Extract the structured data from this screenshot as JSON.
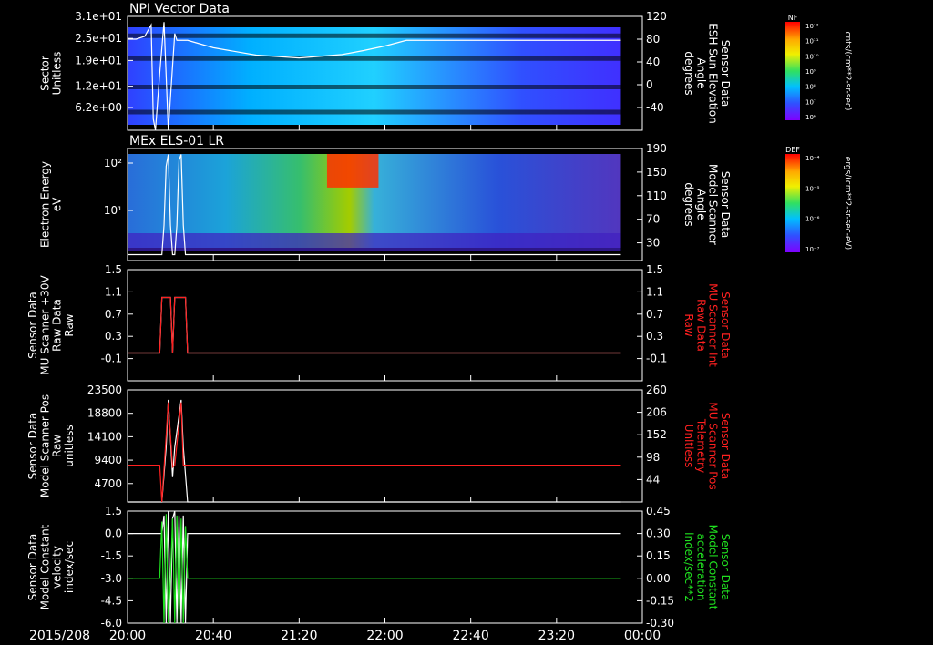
{
  "footer": {
    "date_label": "2015/208"
  },
  "time_axis": {
    "range_minutes": [
      0,
      240
    ],
    "ticks": [
      {
        "t": 0,
        "label": "20:00"
      },
      {
        "t": 40,
        "label": "20:40"
      },
      {
        "t": 80,
        "label": "21:20"
      },
      {
        "t": 120,
        "label": "22:00"
      },
      {
        "t": 160,
        "label": "22:40"
      },
      {
        "t": 200,
        "label": "23:20"
      },
      {
        "t": 240,
        "label": "00:00"
      }
    ]
  },
  "colors": {
    "background": "#000000",
    "axis": "#ffffff",
    "red_series": "#ff2020",
    "green_series": "#20e020"
  },
  "chart_data": [
    {
      "type": "heatmap",
      "title": "NPI Vector Data",
      "ylabel": "Sector\nUnitless",
      "ylim": [
        0,
        31
      ],
      "yticks": [
        "3.1e+01",
        "2.5e+01",
        "1.9e+01",
        "1.2e+01",
        "6.2e+00"
      ],
      "ytick_values": [
        31,
        25,
        19,
        12,
        6.2
      ],
      "y2label": "Sensor Data\nESH Sun Elevation\nAngle\ndegrees",
      "y2lim": [
        -80,
        120
      ],
      "y2ticks": [
        "120",
        "80",
        "40",
        "0",
        "-40"
      ],
      "y2tick_values": [
        120,
        80,
        40,
        0,
        -40
      ],
      "colorbar": {
        "label": "NF",
        "units": "cnts/(cm**2-sr-sec)",
        "ticks": [
          "10¹²",
          "10¹¹",
          "10¹⁰",
          "10⁹",
          "10⁸",
          "10⁷",
          "10⁶"
        ]
      },
      "line_series": [
        {
          "x": [
            0,
            4,
            8,
            11,
            12,
            13,
            15,
            17,
            19,
            22,
            23,
            25,
            28,
            40,
            60,
            80,
            100,
            110,
            120,
            130,
            150,
            175,
            200,
            230
          ],
          "y": [
            80,
            80,
            85,
            105,
            -60,
            -80,
            20,
            110,
            -80,
            90,
            78,
            78,
            78,
            65,
            52,
            47,
            53,
            60,
            68,
            78,
            78,
            78,
            78,
            78
          ]
        }
      ]
    },
    {
      "type": "heatmap",
      "title": "MEx ELS-01 LR",
      "ylabel": "Electron Energy\neV",
      "yscale": "log",
      "yticks": [
        "10²",
        "10¹"
      ],
      "y2label": "Sensor Data\nModel Scanner\nAngle\ndegrees",
      "y2lim": [
        0,
        190
      ],
      "y2ticks": [
        "190",
        "150",
        "110",
        "70",
        "30"
      ],
      "y2tick_values": [
        190,
        150,
        110,
        70,
        30
      ],
      "colorbar": {
        "label": "DEF",
        "units": "ergs/(cm**2-sr-sec-eV)",
        "ticks": [
          "10⁻⁴",
          "10⁻⁵",
          "10⁻⁶",
          "10⁻⁷"
        ]
      },
      "line_series": [
        {
          "x": [
            0,
            16,
            17,
            18,
            19,
            20,
            21,
            22,
            23,
            24,
            25,
            26,
            27,
            30,
            60,
            120,
            200,
            230
          ],
          "y": [
            10,
            10,
            60,
            160,
            180,
            60,
            10,
            10,
            60,
            170,
            180,
            60,
            10,
            10,
            10,
            10,
            10,
            10
          ]
        }
      ]
    },
    {
      "type": "line",
      "ylabel": "Sensor Data\nMU Scanner +30V\nRaw Data\nRaw",
      "ylim": [
        -0.5,
        1.5
      ],
      "yticks": [
        "1.5",
        "1.1",
        "0.7",
        "0.3",
        "-0.1"
      ],
      "ytick_values": [
        1.5,
        1.1,
        0.7,
        0.3,
        -0.1
      ],
      "y2label": "Sensor Data\nMU Scanner Int\nRaw Data\nRaw",
      "y2ticks": [
        "1.5",
        "1.1",
        "0.7",
        "0.3",
        "-0.1"
      ],
      "y2tick_values": [
        1.5,
        1.1,
        0.7,
        0.3,
        -0.1
      ],
      "series": [
        {
          "color": "#ffffff",
          "x": [
            0,
            15,
            16,
            20,
            21,
            22,
            23,
            27,
            28,
            30,
            200,
            230
          ],
          "y": [
            0,
            0,
            1,
            1,
            0,
            1,
            1,
            1,
            0,
            0,
            0,
            0
          ]
        },
        {
          "color": "#ff2020",
          "x": [
            0,
            15,
            16,
            20,
            21,
            22,
            23,
            27,
            28,
            30,
            200,
            230
          ],
          "y": [
            0,
            0,
            1,
            1,
            0,
            1,
            1,
            1,
            0,
            0,
            0,
            0
          ]
        }
      ]
    },
    {
      "type": "line",
      "ylabel": "Sensor Data\nModel Scanner Pos\nRaw\nunitless",
      "ylim": [
        1000,
        23500
      ],
      "yticks": [
        "23500",
        "18800",
        "14100",
        "9400",
        "4700"
      ],
      "ytick_values": [
        23500,
        18800,
        14100,
        9400,
        4700
      ],
      "y2label": "Sensor Data\nMU Scanner Pos\nTelemetry\nUnitless",
      "y2lim": [
        -10,
        260
      ],
      "y2ticks": [
        "260",
        "206",
        "152",
        "98",
        "44"
      ],
      "y2tick_values": [
        260,
        206,
        152,
        98,
        44
      ],
      "series": [
        {
          "color": "#ffffff",
          "x": [
            0,
            16,
            18,
            19,
            21,
            22,
            25,
            26,
            28,
            30,
            200,
            230
          ],
          "y": [
            1000,
            1000,
            12000,
            21500,
            6000,
            12000,
            21500,
            12000,
            1000,
            1000,
            1000,
            1000
          ]
        },
        {
          "color": "#ff2020",
          "x": [
            0,
            15,
            16,
            19,
            21,
            22,
            25,
            26,
            28,
            230
          ],
          "y": [
            8400,
            8400,
            1000,
            21000,
            8000,
            8400,
            21000,
            8400,
            8400,
            8400
          ]
        }
      ]
    },
    {
      "type": "line",
      "ylabel": "Sensor Data\nModel Constant\nvelocity\nindex/sec",
      "ylim": [
        -6.0,
        1.5
      ],
      "yticks": [
        "1.5",
        "0.0",
        "-1.5",
        "-3.0",
        "-4.5",
        "-6.0"
      ],
      "ytick_values": [
        1.5,
        0.0,
        -1.5,
        -3.0,
        -4.5,
        -6.0
      ],
      "y2label": "Sensor Data\nModel Constant\nacceleration\nindex/sec**2",
      "y2lim": [
        -0.3,
        0.45
      ],
      "y2ticks": [
        "0.45",
        "0.30",
        "0.15",
        "0.00",
        "-0.15",
        "-0.30"
      ],
      "y2tick_values": [
        0.45,
        0.3,
        0.15,
        0.0,
        -0.15,
        -0.3
      ],
      "series": [
        {
          "color": "#ffffff",
          "x": [
            0,
            16,
            17,
            18,
            19,
            20,
            21,
            22,
            23,
            24,
            25,
            26,
            27,
            28,
            30,
            200,
            230
          ],
          "y": [
            0,
            0,
            1.2,
            -6,
            1.5,
            -6,
            1.0,
            1.5,
            -6,
            1.2,
            -6,
            1.2,
            -6,
            0,
            0,
            0,
            0
          ]
        },
        {
          "color": "#20e020",
          "x": [
            0,
            15,
            16,
            17,
            18,
            19,
            20,
            21,
            22,
            23,
            24,
            25,
            26,
            27,
            28,
            230
          ],
          "y": [
            -3,
            -3,
            0.8,
            -6,
            1.3,
            -6,
            -3,
            1.0,
            -6,
            1.2,
            -6,
            1.0,
            -6,
            0.5,
            -3,
            -3
          ]
        }
      ]
    }
  ]
}
